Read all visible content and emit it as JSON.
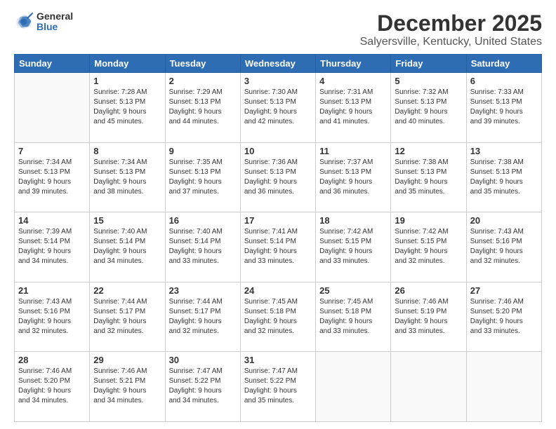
{
  "header": {
    "logo_general": "General",
    "logo_blue": "Blue",
    "title": "December 2025",
    "subtitle": "Salyersville, Kentucky, United States"
  },
  "calendar": {
    "days_of_week": [
      "Sunday",
      "Monday",
      "Tuesday",
      "Wednesday",
      "Thursday",
      "Friday",
      "Saturday"
    ],
    "weeks": [
      [
        {
          "day": "",
          "content": ""
        },
        {
          "day": "1",
          "content": "Sunrise: 7:28 AM\nSunset: 5:13 PM\nDaylight: 9 hours\nand 45 minutes."
        },
        {
          "day": "2",
          "content": "Sunrise: 7:29 AM\nSunset: 5:13 PM\nDaylight: 9 hours\nand 44 minutes."
        },
        {
          "day": "3",
          "content": "Sunrise: 7:30 AM\nSunset: 5:13 PM\nDaylight: 9 hours\nand 42 minutes."
        },
        {
          "day": "4",
          "content": "Sunrise: 7:31 AM\nSunset: 5:13 PM\nDaylight: 9 hours\nand 41 minutes."
        },
        {
          "day": "5",
          "content": "Sunrise: 7:32 AM\nSunset: 5:13 PM\nDaylight: 9 hours\nand 40 minutes."
        },
        {
          "day": "6",
          "content": "Sunrise: 7:33 AM\nSunset: 5:13 PM\nDaylight: 9 hours\nand 39 minutes."
        }
      ],
      [
        {
          "day": "7",
          "content": "Sunrise: 7:34 AM\nSunset: 5:13 PM\nDaylight: 9 hours\nand 39 minutes."
        },
        {
          "day": "8",
          "content": "Sunrise: 7:34 AM\nSunset: 5:13 PM\nDaylight: 9 hours\nand 38 minutes."
        },
        {
          "day": "9",
          "content": "Sunrise: 7:35 AM\nSunset: 5:13 PM\nDaylight: 9 hours\nand 37 minutes."
        },
        {
          "day": "10",
          "content": "Sunrise: 7:36 AM\nSunset: 5:13 PM\nDaylight: 9 hours\nand 36 minutes."
        },
        {
          "day": "11",
          "content": "Sunrise: 7:37 AM\nSunset: 5:13 PM\nDaylight: 9 hours\nand 36 minutes."
        },
        {
          "day": "12",
          "content": "Sunrise: 7:38 AM\nSunset: 5:13 PM\nDaylight: 9 hours\nand 35 minutes."
        },
        {
          "day": "13",
          "content": "Sunrise: 7:38 AM\nSunset: 5:13 PM\nDaylight: 9 hours\nand 35 minutes."
        }
      ],
      [
        {
          "day": "14",
          "content": "Sunrise: 7:39 AM\nSunset: 5:14 PM\nDaylight: 9 hours\nand 34 minutes."
        },
        {
          "day": "15",
          "content": "Sunrise: 7:40 AM\nSunset: 5:14 PM\nDaylight: 9 hours\nand 34 minutes."
        },
        {
          "day": "16",
          "content": "Sunrise: 7:40 AM\nSunset: 5:14 PM\nDaylight: 9 hours\nand 33 minutes."
        },
        {
          "day": "17",
          "content": "Sunrise: 7:41 AM\nSunset: 5:14 PM\nDaylight: 9 hours\nand 33 minutes."
        },
        {
          "day": "18",
          "content": "Sunrise: 7:42 AM\nSunset: 5:15 PM\nDaylight: 9 hours\nand 33 minutes."
        },
        {
          "day": "19",
          "content": "Sunrise: 7:42 AM\nSunset: 5:15 PM\nDaylight: 9 hours\nand 32 minutes."
        },
        {
          "day": "20",
          "content": "Sunrise: 7:43 AM\nSunset: 5:16 PM\nDaylight: 9 hours\nand 32 minutes."
        }
      ],
      [
        {
          "day": "21",
          "content": "Sunrise: 7:43 AM\nSunset: 5:16 PM\nDaylight: 9 hours\nand 32 minutes."
        },
        {
          "day": "22",
          "content": "Sunrise: 7:44 AM\nSunset: 5:17 PM\nDaylight: 9 hours\nand 32 minutes."
        },
        {
          "day": "23",
          "content": "Sunrise: 7:44 AM\nSunset: 5:17 PM\nDaylight: 9 hours\nand 32 minutes."
        },
        {
          "day": "24",
          "content": "Sunrise: 7:45 AM\nSunset: 5:18 PM\nDaylight: 9 hours\nand 32 minutes."
        },
        {
          "day": "25",
          "content": "Sunrise: 7:45 AM\nSunset: 5:18 PM\nDaylight: 9 hours\nand 33 minutes."
        },
        {
          "day": "26",
          "content": "Sunrise: 7:46 AM\nSunset: 5:19 PM\nDaylight: 9 hours\nand 33 minutes."
        },
        {
          "day": "27",
          "content": "Sunrise: 7:46 AM\nSunset: 5:20 PM\nDaylight: 9 hours\nand 33 minutes."
        }
      ],
      [
        {
          "day": "28",
          "content": "Sunrise: 7:46 AM\nSunset: 5:20 PM\nDaylight: 9 hours\nand 34 minutes."
        },
        {
          "day": "29",
          "content": "Sunrise: 7:46 AM\nSunset: 5:21 PM\nDaylight: 9 hours\nand 34 minutes."
        },
        {
          "day": "30",
          "content": "Sunrise: 7:47 AM\nSunset: 5:22 PM\nDaylight: 9 hours\nand 34 minutes."
        },
        {
          "day": "31",
          "content": "Sunrise: 7:47 AM\nSunset: 5:22 PM\nDaylight: 9 hours\nand 35 minutes."
        },
        {
          "day": "",
          "content": ""
        },
        {
          "day": "",
          "content": ""
        },
        {
          "day": "",
          "content": ""
        }
      ]
    ]
  }
}
